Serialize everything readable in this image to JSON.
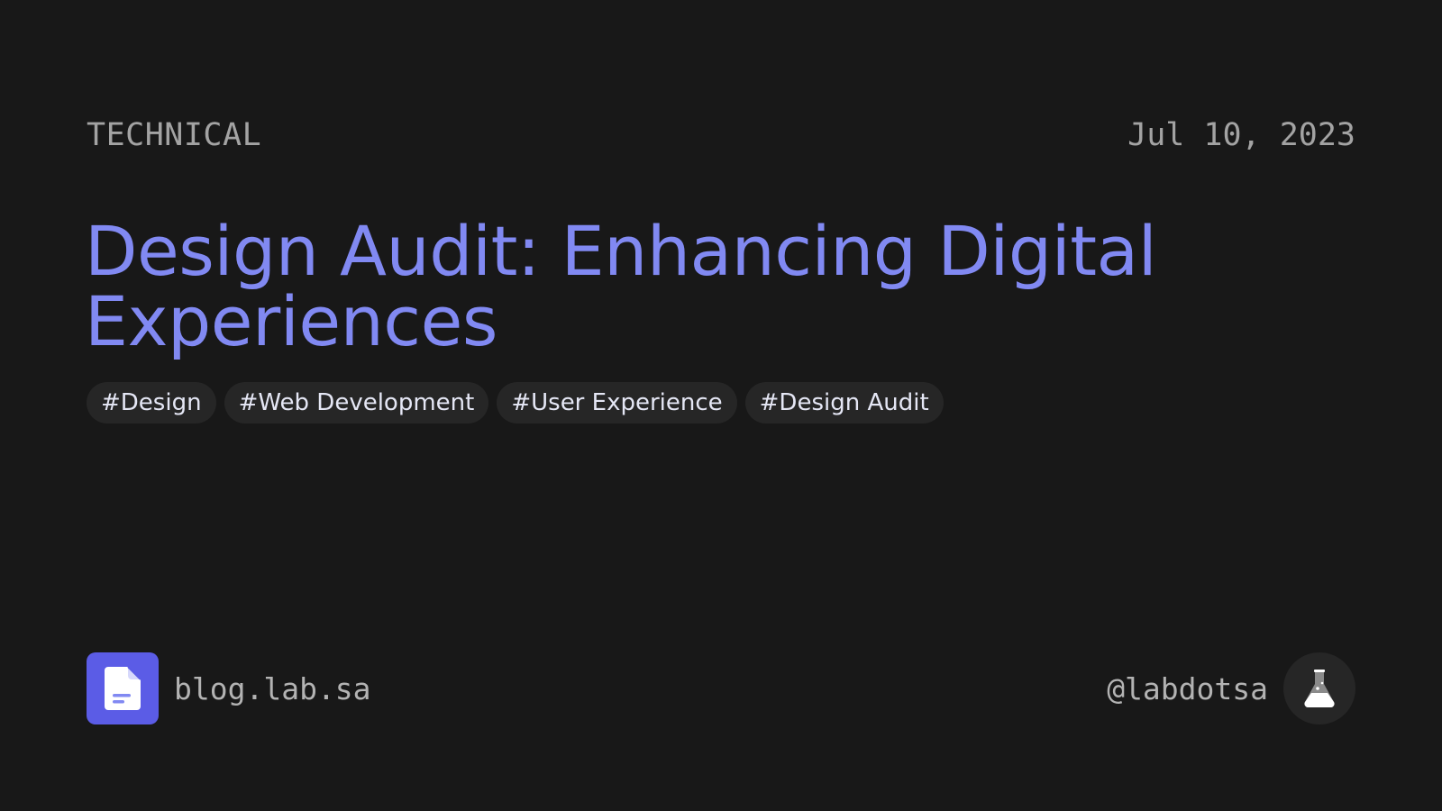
{
  "post": {
    "category": "TECHNICAL",
    "date": "Jul 10, 2023",
    "title": "Design Audit: Enhancing Digital Experiences",
    "tags": [
      "#Design",
      "#Web Development",
      "#User Experience",
      "#Design Audit"
    ]
  },
  "footer": {
    "site": "blog.lab.sa",
    "handle": "@labdotsa",
    "site_icon": "document-icon",
    "avatar_icon": "flask-icon"
  },
  "colors": {
    "background": "#181818",
    "accent": "#8189f2",
    "logo_bg": "#5b5ce6",
    "tag_bg": "#262626",
    "muted_text": "#a3a3a3"
  }
}
